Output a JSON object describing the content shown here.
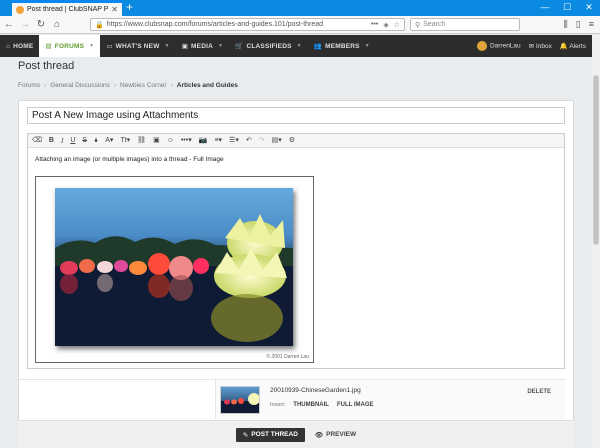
{
  "browser": {
    "tab_title": "Post thread | ClubSNAP Photo...",
    "new_tab": "+",
    "url": "https://www.clubsnap.com/forums/articles-and-guides.101/post-thread",
    "search_placeholder": "Search",
    "window_minimize": "—",
    "window_maximize": "☐",
    "window_close": "✕"
  },
  "sitenav": {
    "items": [
      {
        "label": "HOME",
        "icon": "home-icon"
      },
      {
        "label": "FORUMS",
        "icon": "forum-icon"
      },
      {
        "label": "WHAT'S NEW",
        "icon": "speech-icon"
      },
      {
        "label": "MEDIA",
        "icon": "image-icon"
      },
      {
        "label": "CLASSIFIEDS",
        "icon": "cart-icon"
      },
      {
        "label": "MEMBERS",
        "icon": "users-icon"
      }
    ],
    "username": "DarrenLau",
    "inbox": "Inbox",
    "alerts": "Alerts"
  },
  "page": {
    "title": "Post thread",
    "breadcrumbs": [
      "Forums",
      "General Discussions",
      "Newbies Corner",
      "Articles and Guides"
    ]
  },
  "editor": {
    "thread_title": "Post A New Image using Attachments",
    "body_text": "Attaching an image (or multiple images) into a thread - Full Image",
    "image_copyright": "© 2001 Darren Lau"
  },
  "attachment": {
    "filename": "20010939-ChineseGarden1.jpg",
    "insert_label": "Insert:",
    "thumbnail_label": "THUMBNAIL",
    "full_image_label": "FULL IMAGE",
    "delete_label": "DELETE"
  },
  "actions": {
    "post_label": "POST THREAD",
    "preview_label": "PREVIEW"
  }
}
